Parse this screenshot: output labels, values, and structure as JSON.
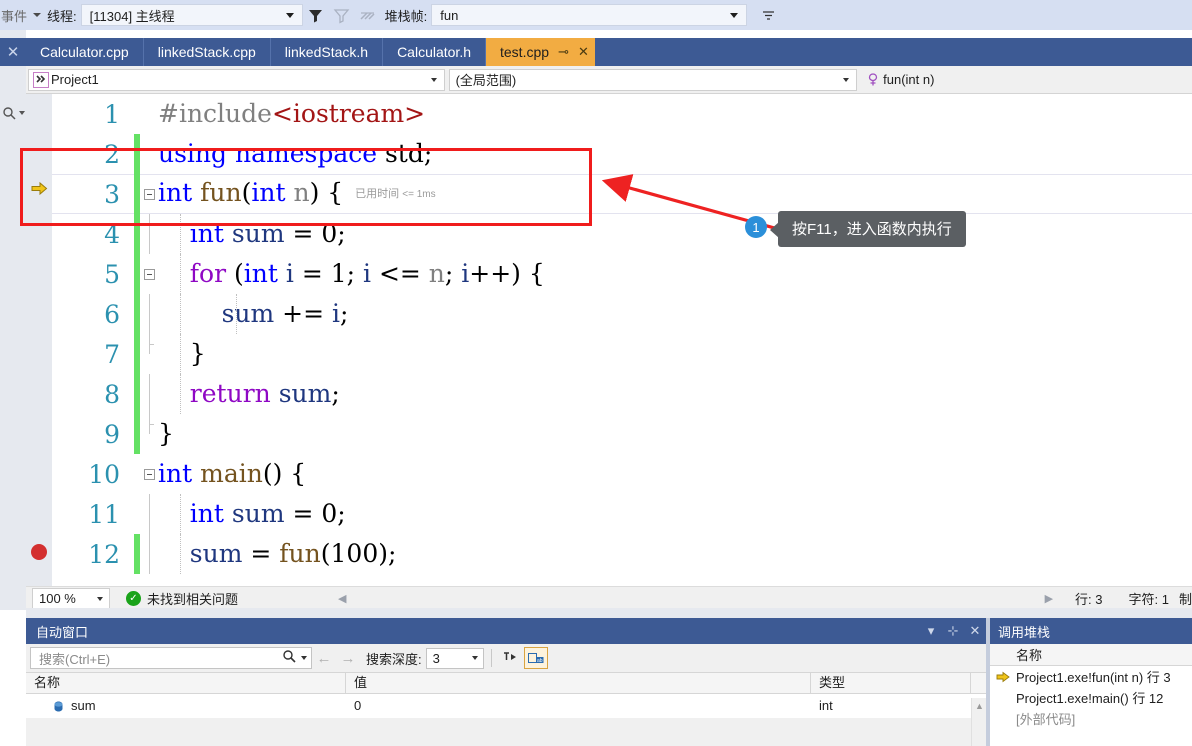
{
  "debug_toolbar": {
    "partial_label": "事件",
    "thread_label": "线程:",
    "thread_value": "[11304] 主线程",
    "filter_icon": "funnel-icon",
    "filter_icon2": "funnel-clear-icon",
    "flatten_icon": "flatten-icon",
    "frame_label": "堆栈帧:",
    "frame_value": "fun",
    "overflow_icon": "toolbar-overflow-icon"
  },
  "left_strip": {
    "close_label": "✕",
    "mini_label": "⌕"
  },
  "tabs": [
    {
      "label": "Calculator.cpp",
      "active": false
    },
    {
      "label": "linkedStack.cpp",
      "active": false
    },
    {
      "label": "linkedStack.h",
      "active": false
    },
    {
      "label": "Calculator.h",
      "active": false
    },
    {
      "label": "test.cpp",
      "active": true,
      "pin": "⊸",
      "close": "✕"
    }
  ],
  "navbar": {
    "project": "Project1",
    "project_icon": "project-icon",
    "scope": "(全局范围)",
    "member": "fun(int n)",
    "member_icon": "method-icon"
  },
  "editor": {
    "lines": [
      {
        "num": "1",
        "change": false,
        "fold": "none",
        "tokens": [
          {
            "t": "#include",
            "c": "t-pre"
          },
          {
            "t": "<iostream>",
            "c": "t-str"
          }
        ],
        "indent": 0
      },
      {
        "num": "2",
        "change": true,
        "fold": "none",
        "tokens": [
          {
            "t": "using namespace",
            "c": "t-kw"
          },
          {
            "t": " std;",
            "c": "t-punc"
          }
        ],
        "indent": 0
      },
      {
        "num": "3",
        "change": true,
        "fold": "open",
        "current": true,
        "tokens": [
          {
            "t": "int",
            "c": "t-kw"
          },
          {
            "t": " ",
            "c": "t-punc"
          },
          {
            "t": "fun",
            "c": "t-fn"
          },
          {
            "t": "(",
            "c": "t-punc"
          },
          {
            "t": "int",
            "c": "t-kw"
          },
          {
            "t": " ",
            "c": "t-punc"
          },
          {
            "t": "n",
            "c": "t-id"
          },
          {
            "t": ") {",
            "c": "t-punc"
          }
        ],
        "elapsed": "已用时间",
        "elapsed_val": "<= 1ms",
        "indent": 0
      },
      {
        "num": "4",
        "change": true,
        "fold": "line",
        "tokens": [
          {
            "t": "    ",
            "c": "t-punc"
          },
          {
            "t": "int",
            "c": "t-kw"
          },
          {
            "t": " ",
            "c": "t-punc"
          },
          {
            "t": "sum",
            "c": "t-var"
          },
          {
            "t": " = ",
            "c": "t-punc"
          },
          {
            "t": "0",
            "c": "t-num"
          },
          {
            "t": ";",
            "c": "t-punc"
          }
        ],
        "indent": 1
      },
      {
        "num": "5",
        "change": true,
        "fold": "open2",
        "tokens": [
          {
            "t": "    ",
            "c": "t-punc"
          },
          {
            "t": "for",
            "c": "t-kw2"
          },
          {
            "t": " (",
            "c": "t-punc"
          },
          {
            "t": "int",
            "c": "t-kw"
          },
          {
            "t": " ",
            "c": "t-punc"
          },
          {
            "t": "i",
            "c": "t-var"
          },
          {
            "t": " = ",
            "c": "t-punc"
          },
          {
            "t": "1",
            "c": "t-num"
          },
          {
            "t": "; ",
            "c": "t-punc"
          },
          {
            "t": "i",
            "c": "t-var"
          },
          {
            "t": " <= ",
            "c": "t-punc"
          },
          {
            "t": "n",
            "c": "t-id"
          },
          {
            "t": "; ",
            "c": "t-punc"
          },
          {
            "t": "i",
            "c": "t-var"
          },
          {
            "t": "++) {",
            "c": "t-punc"
          }
        ],
        "indent": 1
      },
      {
        "num": "6",
        "change": true,
        "fold": "line2",
        "tokens": [
          {
            "t": "        ",
            "c": "t-punc"
          },
          {
            "t": "sum",
            "c": "t-var"
          },
          {
            "t": " += ",
            "c": "t-punc"
          },
          {
            "t": "i",
            "c": "t-var"
          },
          {
            "t": ";",
            "c": "t-punc"
          }
        ],
        "indent": 2
      },
      {
        "num": "7",
        "change": true,
        "fold": "end2",
        "tokens": [
          {
            "t": "    }",
            "c": "t-punc"
          }
        ],
        "indent": 1
      },
      {
        "num": "8",
        "change": true,
        "fold": "line",
        "tokens": [
          {
            "t": "    ",
            "c": "t-punc"
          },
          {
            "t": "return",
            "c": "t-kw2"
          },
          {
            "t": " ",
            "c": "t-punc"
          },
          {
            "t": "sum",
            "c": "t-var"
          },
          {
            "t": ";",
            "c": "t-punc"
          }
        ],
        "indent": 1
      },
      {
        "num": "9",
        "change": true,
        "fold": "end",
        "tokens": [
          {
            "t": "}",
            "c": "t-punc"
          }
        ],
        "indent": 0
      },
      {
        "num": "10",
        "change": false,
        "fold": "open",
        "tokens": [
          {
            "t": "int",
            "c": "t-kw"
          },
          {
            "t": " ",
            "c": "t-punc"
          },
          {
            "t": "main",
            "c": "t-fn"
          },
          {
            "t": "() {",
            "c": "t-punc"
          }
        ],
        "indent": 0
      },
      {
        "num": "11",
        "change": false,
        "fold": "line",
        "tokens": [
          {
            "t": "    ",
            "c": "t-punc"
          },
          {
            "t": "int",
            "c": "t-kw"
          },
          {
            "t": " ",
            "c": "t-punc"
          },
          {
            "t": "sum",
            "c": "t-var"
          },
          {
            "t": " = ",
            "c": "t-punc"
          },
          {
            "t": "0",
            "c": "t-num"
          },
          {
            "t": ";",
            "c": "t-punc"
          }
        ],
        "indent": 1
      },
      {
        "num": "12",
        "change": true,
        "fold": "line",
        "breakpoint": true,
        "tokens": [
          {
            "t": "    ",
            "c": "t-punc"
          },
          {
            "t": "sum",
            "c": "t-var"
          },
          {
            "t": " = ",
            "c": "t-punc"
          },
          {
            "t": "fun",
            "c": "t-fn"
          },
          {
            "t": "(",
            "c": "t-punc"
          },
          {
            "t": "100",
            "c": "t-num"
          },
          {
            "t": ");",
            "c": "t-punc"
          }
        ],
        "indent": 1
      }
    ],
    "exec_marker_line": 3,
    "breakpoint_line": 12
  },
  "annotation": {
    "badge": "1",
    "callout_text": "按F11，进入函数内执行",
    "box_color": "#f01c1c",
    "arrow_color": "#ee2222",
    "badge_color": "#2b8fd9",
    "callout_bg": "#5b5f63"
  },
  "editor_status": {
    "zoom": "100 %",
    "problems_icon": "check-circle-icon",
    "problems_text": "未找到相关问题",
    "line_label": "行: 3",
    "char_label": "字符: 1",
    "extra_partial": "制"
  },
  "autos_panel": {
    "title": "自动窗口",
    "tools": {
      "dropdown": "▾",
      "pin": "⊹",
      "close": "✕"
    },
    "search_placeholder": "搜索(Ctrl+E)",
    "search_icon": "search-icon",
    "search_dropdown_icon": "chevron-down-icon",
    "back_icon": "←",
    "forward_icon": "→",
    "depth_label": "搜索深度:",
    "depth_value": "3",
    "pin_tool_icon": "pin-columns-icon",
    "hex_tool_icon": "hex-display-icon",
    "columns": [
      "名称",
      "值",
      "类型"
    ],
    "rows": [
      {
        "name": "sum",
        "value": "0",
        "type": "int",
        "icon": "variable-icon"
      }
    ]
  },
  "callstack_panel": {
    "title": "调用堆栈",
    "column": "名称",
    "rows": [
      {
        "text": "Project1.exe!fun(int n) 行 3",
        "current": true
      },
      {
        "text": "Project1.exe!main() 行 12",
        "current": false
      },
      {
        "text": "[外部代码]",
        "current": false,
        "external": true
      }
    ]
  }
}
